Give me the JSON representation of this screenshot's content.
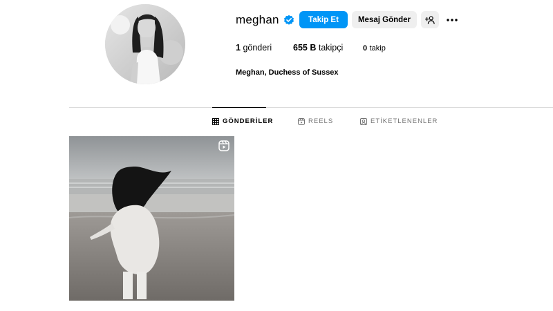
{
  "profile": {
    "username": "meghan",
    "verified": true,
    "full_name": "Meghan, Duchess of Sussex"
  },
  "actions": {
    "follow_label": "Takip Et",
    "message_label": "Mesaj Gönder",
    "add_user_icon": "add-user-icon",
    "more_icon": "more-options-icon"
  },
  "stats": {
    "posts_count": "1",
    "posts_label": "gönderi",
    "followers_count": "655 B",
    "followers_label": "takipçi",
    "following_count": "0",
    "following_label": "takip"
  },
  "tabs": [
    {
      "label": "GÖNDERİLER",
      "icon": "grid-icon",
      "active": true
    },
    {
      "label": "REELS",
      "icon": "reels-icon",
      "active": false
    },
    {
      "label": "ETİKETLENENLER",
      "icon": "tagged-icon",
      "active": false
    }
  ],
  "posts": [
    {
      "type": "reel",
      "icon": "reel-icon"
    }
  ],
  "colors": {
    "accent": "#0095f6",
    "secondary_button": "#efefef",
    "divider": "#dbdbdb",
    "muted_text": "#737373"
  }
}
